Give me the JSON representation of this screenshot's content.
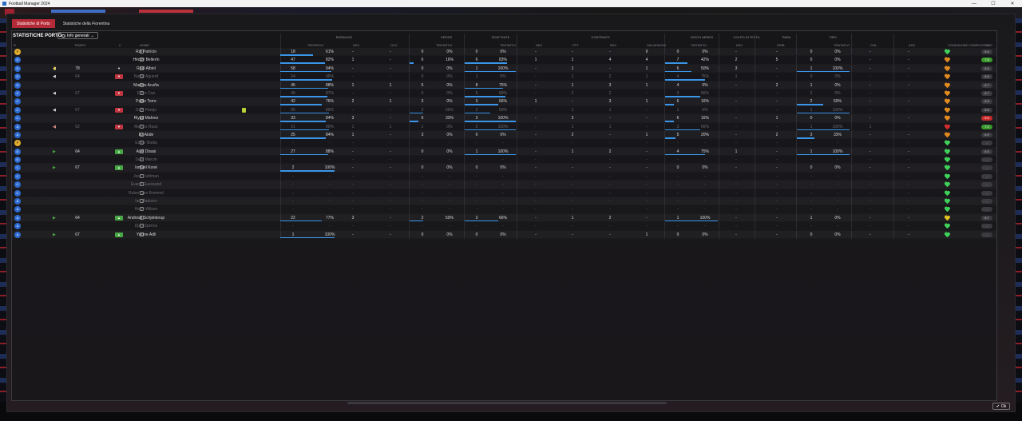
{
  "window": {
    "title": "Football Manager 2024",
    "controls": [
      "—",
      "☐",
      "✕"
    ]
  },
  "tabs": [
    {
      "label": "Statistiche di Porto",
      "active": true
    },
    {
      "label": "Statistiche della Fiorentina",
      "active": false
    }
  ],
  "panel": {
    "title": "STATISTICHE PORTO",
    "view_select": "Info generali"
  },
  "groups": [
    "PASSAGGI",
    "CROSS",
    "SCATTI/ATE",
    "CONTRASTI",
    "GIOCO AEREO",
    "COLPO DI TESTA",
    "PARA",
    "TIRO"
  ],
  "columns": [
    "R",
    "TEMPO",
    "C",
    "NOME",
    "TENTATIVI",
    "DEC",
    "OCC",
    "TENTATIVI",
    "TENTATIVI",
    "DEC",
    "FPT",
    "REC",
    "SALVATAGGI",
    "TENTATIVI",
    "DEC",
    "DRIB",
    "TENTATIVI",
    "GOL",
    "ASS",
    "CONDIZIONE COMPLESSIV...",
    "VOT"
  ],
  "colors": {
    "accent": "#b52a37",
    "bar": "#3a95e8",
    "heart_green": "#3fd15a",
    "heart_yellow": "#e0c020",
    "heart_orange": "#e08a20",
    "heart_red": "#d32d2d"
  },
  "players": [
    {
      "pos": "P",
      "gk": true,
      "name": "Rui Patrício",
      "pass": [
        "18",
        "61%"
      ],
      "dec": "-",
      "occ": "-",
      "cross": [
        "0",
        "0%"
      ],
      "sc": [
        "0",
        "0%"
      ],
      "tdec": "-",
      "fpt": "-",
      "rec": "-",
      "salv": "9",
      "aer": [
        "0",
        "0%"
      ],
      "hdec": "-",
      "drib": "-",
      "shot": [
        "0",
        "0%"
      ],
      "gol": "-",
      "ass": "-",
      "cond": "#3fd15a",
      "vot": "6.6",
      "vclass": "",
      "dim": false
    },
    {
      "pos": "D",
      "name": "Héctor Bellerín",
      "pass": [
        "47",
        "82%"
      ],
      "dec": "1",
      "occ": "-",
      "cross": [
        "6",
        "16%"
      ],
      "sc": [
        "6",
        "83%"
      ],
      "tdec": "1",
      "fpt": "1",
      "rec": "4",
      "salv": "4",
      "aer": [
        "7",
        "42%"
      ],
      "hdec": "2",
      "drib": "5",
      "shot": [
        "0",
        "0%"
      ],
      "gol": "-",
      "ass": "-",
      "cond": "#e08a20",
      "vot": "7.5",
      "vclass": "hi",
      "dim": false
    },
    {
      "pos": "D",
      "name": "Raúl Albiol",
      "time": "78",
      "pass": [
        "58",
        "94%"
      ],
      "dec": "-",
      "occ": "-",
      "cross": [
        "0",
        "0%"
      ],
      "sc": [
        "1",
        "100%"
      ],
      "tdec": "-",
      "fpt": "1",
      "rec": "-",
      "salv": "1",
      "aer": [
        "6",
        "50%"
      ],
      "hdec": "3",
      "drib": "-",
      "shot": [
        "1",
        "100%"
      ],
      "gol": "-",
      "ass": "-",
      "cond": "#e08a20",
      "vot": "6.6",
      "vclass": "",
      "dim": false
    },
    {
      "pos": "D",
      "name": "Nayef Aguerd",
      "time": "64",
      "badge": "sub-off",
      "pass": [
        "24",
        "95%"
      ],
      "dec": "-",
      "occ": "-",
      "cross": [
        "0",
        "0%"
      ],
      "sc": [
        "1",
        "0%"
      ],
      "tdec": "-",
      "fpt": "1",
      "rec": "2",
      "salv": "1",
      "aer": [
        "4",
        "75%"
      ],
      "hdec": "1",
      "drib": "-",
      "shot": [
        "0",
        "0%"
      ],
      "gol": "-",
      "ass": "-",
      "cond": "#e08a20",
      "vot": "6.5",
      "vclass": "",
      "dim": true
    },
    {
      "pos": "D",
      "name": "Marcos Acuña",
      "pass": [
        "45",
        "88%"
      ],
      "dec": "1",
      "occ": "1",
      "cross": [
        "5",
        "0%"
      ],
      "sc": [
        "8",
        "75%"
      ],
      "tdec": "-",
      "fpt": "1",
      "rec": "3",
      "salv": "1",
      "aer": [
        "4",
        "0%"
      ],
      "hdec": "-",
      "drib": "2",
      "shot": [
        "1",
        "0%"
      ],
      "gol": "-",
      "ass": "-",
      "cond": "#e08a20",
      "vot": "6.7",
      "vclass": "",
      "dim": false
    },
    {
      "pos": "C",
      "name": "Emre Can",
      "time": "67",
      "badge": "sub-off",
      "pass": [
        "49",
        "87%"
      ],
      "dec": "-",
      "occ": "-",
      "cross": [
        "0",
        "0%"
      ],
      "sc": [
        "5",
        "80%"
      ],
      "tdec": "-",
      "fpt": "2",
      "rec": "2",
      "salv": "-",
      "aer": [
        "3",
        "66%"
      ],
      "hdec": "-",
      "drib": "-",
      "shot": [
        "2",
        "0%"
      ],
      "gol": "-",
      "ass": "-",
      "cond": "#e08a20",
      "vot": "6.7",
      "vclass": "",
      "dim": true
    },
    {
      "pos": "C",
      "name": "Pablo Torre",
      "pass": [
        "42",
        "76%"
      ],
      "dec": "2",
      "occ": "1",
      "cross": [
        "3",
        "0%"
      ],
      "sc": [
        "3",
        "66%"
      ],
      "tdec": "1",
      "fpt": "-",
      "rec": "3",
      "salv": "1",
      "aer": [
        "6",
        "16%"
      ],
      "hdec": "-",
      "drib": "-",
      "shot": [
        "2",
        "50%"
      ],
      "gol": "-",
      "ass": "-",
      "cond": "#e08a20",
      "vot": "6.5",
      "vclass": "",
      "dim": false
    },
    {
      "pos": "C",
      "name": "Dani Parejo",
      "time": "67",
      "badge": "sub-off",
      "card": true,
      "pass": [
        "55",
        "89%"
      ],
      "dec": "-",
      "occ": "-",
      "cross": [
        "2",
        "50%"
      ],
      "sc": [
        "2",
        "50%"
      ],
      "tdec": "-",
      "fpt": "1",
      "rec": "1",
      "salv": "-",
      "aer": [
        "1",
        "0%"
      ],
      "hdec": "-",
      "drib": "-",
      "shot": [
        "1",
        "100%"
      ],
      "gol": "-",
      "ass": "-",
      "cond": "#e08a20",
      "vot": "6.6",
      "vclass": "",
      "dim": true
    },
    {
      "pos": "C",
      "name": "Riyad Mahrez",
      "pass": [
        "33",
        "84%"
      ],
      "dec": "3",
      "occ": "-",
      "cross": [
        "6",
        "33%"
      ],
      "sc": [
        "3",
        "100%"
      ],
      "tdec": "-",
      "fpt": "3",
      "rec": "-",
      "salv": "-",
      "aer": [
        "6",
        "16%"
      ],
      "hdec": "-",
      "drib": "1",
      "shot": [
        "0",
        "0%"
      ],
      "gol": "-",
      "ass": "-",
      "cond": "#e08a20",
      "vot": "5.5",
      "vclass": "lo",
      "dim": false
    },
    {
      "pos": "A",
      "name": "Marcos Raus",
      "time": "62",
      "badge": "sub-off",
      "ball": true,
      "pass": [
        "21",
        "90%"
      ],
      "dec": "1",
      "occ": "1",
      "cross": [
        "1",
        "0%"
      ],
      "sc": [
        "2",
        "100%"
      ],
      "tdec": "-",
      "fpt": "1",
      "rec": "1",
      "salv": "-",
      "aer": [
        "3",
        "66%"
      ],
      "hdec": "-",
      "drib": "-",
      "shot": [
        "1",
        "100%"
      ],
      "gol": "1",
      "ass": "-",
      "cond": "#d32d2d",
      "vot": "7.2",
      "vclass": "hi",
      "dim": true
    },
    {
      "pos": "A",
      "name": "Ez Abde",
      "pass": [
        "25",
        "84%"
      ],
      "dec": "1",
      "occ": "-",
      "cross": [
        "3",
        "0%"
      ],
      "sc": [
        "0",
        "0%"
      ],
      "tdec": "-",
      "fpt": "2",
      "rec": "-",
      "salv": "1",
      "aer": [
        "5",
        "20%"
      ],
      "hdec": "-",
      "drib": "2",
      "shot": [
        "3",
        "33%"
      ],
      "gol": "-",
      "ass": "-",
      "cond": "#e08a20",
      "vot": "6.9",
      "vclass": "",
      "dim": false
    },
    {
      "pos": "P",
      "gk": true,
      "name": "Edgar Badia",
      "pass": [
        "-",
        "-"
      ],
      "dec": "-",
      "occ": "-",
      "cross": [
        "-",
        "-"
      ],
      "sc": [
        "-",
        "-"
      ],
      "tdec": "-",
      "fpt": "-",
      "rec": "-",
      "salv": "-",
      "aer": [
        "-",
        "-"
      ],
      "hdec": "-",
      "drib": "-",
      "shot": [
        "-",
        "-"
      ],
      "gol": "-",
      "ass": "-",
      "cond": "#3fd15a",
      "vot": "-",
      "vclass": "",
      "dim": true
    },
    {
      "pos": "D",
      "name": "Axel Disasi",
      "time": "64",
      "badge": "sub-on",
      "pass": [
        "27",
        "88%"
      ],
      "dec": "-",
      "occ": "-",
      "cross": [
        "0",
        "0%"
      ],
      "sc": [
        "1",
        "100%"
      ],
      "tdec": "-",
      "fpt": "1",
      "rec": "2",
      "salv": "-",
      "aer": [
        "4",
        "75%"
      ],
      "hdec": "1",
      "drib": "-",
      "shot": [
        "1",
        "100%"
      ],
      "gol": "-",
      "ass": "-",
      "cond": "#3fd15a",
      "vot": "6.5",
      "vclass": "",
      "dim": false
    },
    {
      "pos": "D",
      "name": "Sully Marcin",
      "pass": [
        "-",
        "-"
      ],
      "dec": "-",
      "occ": "-",
      "cross": [
        "-",
        "-"
      ],
      "sc": [
        "-",
        "-"
      ],
      "tdec": "-",
      "fpt": "-",
      "rec": "-",
      "salv": "-",
      "aer": [
        "-",
        "-"
      ],
      "hdec": "-",
      "drib": "-",
      "shot": [
        "-",
        "-"
      ],
      "gol": "-",
      "ass": "-",
      "cond": "#3fd15a",
      "vot": "-",
      "vclass": "",
      "dim": true
    },
    {
      "pos": "C",
      "name": "Ismaël Koné",
      "time": "67",
      "badge": "sub-on",
      "pass": [
        "2",
        "100%"
      ],
      "dec": "-",
      "occ": "-",
      "cross": [
        "0",
        "0%"
      ],
      "sc": [
        "0",
        "0%"
      ],
      "tdec": "-",
      "fpt": "-",
      "rec": "-",
      "salv": "-",
      "aer": [
        "0",
        "0%"
      ],
      "hdec": "-",
      "drib": "-",
      "shot": [
        "0",
        "0%"
      ],
      "gol": "-",
      "ass": "-",
      "cond": "#3fd15a",
      "vot": "-",
      "vclass": "",
      "dim": false
    },
    {
      "pos": "C",
      "name": "Jesé Kuhlman",
      "pass": [
        "-",
        "-"
      ],
      "dec": "-",
      "occ": "-",
      "cross": [
        "-",
        "-"
      ],
      "sc": [
        "-",
        "-"
      ],
      "tdec": "-",
      "fpt": "-",
      "rec": "-",
      "salv": "-",
      "aer": [
        "-",
        "-"
      ],
      "hdec": "-",
      "drib": "-",
      "shot": [
        "-",
        "-"
      ],
      "gol": "-",
      "ass": "-",
      "cond": "#3fd15a",
      "vot": "-",
      "vclass": "",
      "dim": true
    },
    {
      "pos": "C",
      "name": "Evann Guessand",
      "pass": [
        "-",
        "-"
      ],
      "dec": "-",
      "occ": "-",
      "cross": [
        "-",
        "-"
      ],
      "sc": [
        "-",
        "-"
      ],
      "tdec": "-",
      "fpt": "-",
      "rec": "-",
      "salv": "-",
      "aer": [
        "-",
        "-"
      ],
      "hdec": "-",
      "drib": "-",
      "shot": [
        "-",
        "-"
      ],
      "gol": "-",
      "ass": "-",
      "cond": "#3fd15a",
      "vot": "-",
      "vclass": "",
      "dim": true
    },
    {
      "pos": "C",
      "name": "Ruben van Bommel",
      "pass": [
        "-",
        "-"
      ],
      "dec": "-",
      "occ": "-",
      "cross": [
        "-",
        "-"
      ],
      "sc": [
        "-",
        "-"
      ],
      "tdec": "-",
      "fpt": "-",
      "rec": "-",
      "salv": "-",
      "aer": [
        "-",
        "-"
      ],
      "hdec": "-",
      "drib": "-",
      "shot": [
        "-",
        "-"
      ],
      "gol": "-",
      "ass": "-",
      "cond": "#3fd15a",
      "vot": "-",
      "vclass": "",
      "dim": true
    },
    {
      "pos": "A",
      "name": "Ian Maatsen",
      "pass": [
        "-",
        "-"
      ],
      "dec": "-",
      "occ": "-",
      "cross": [
        "-",
        "-"
      ],
      "sc": [
        "-",
        "-"
      ],
      "tdec": "-",
      "fpt": "-",
      "rec": "-",
      "salv": "-",
      "aer": [
        "-",
        "-"
      ],
      "hdec": "-",
      "drib": "-",
      "shot": [
        "-",
        "-"
      ],
      "gol": "-",
      "ass": "-",
      "cond": "#3fd15a",
      "vot": "-",
      "vclass": "",
      "dim": true
    },
    {
      "pos": "A",
      "name": "Harry Wilson",
      "pass": [
        "-",
        "-"
      ],
      "dec": "-",
      "occ": "-",
      "cross": [
        "-",
        "-"
      ],
      "sc": [
        "-",
        "-"
      ],
      "tdec": "-",
      "fpt": "-",
      "rec": "-",
      "salv": "-",
      "aer": [
        "-",
        "-"
      ],
      "hdec": "-",
      "drib": "-",
      "shot": [
        "-",
        "-"
      ],
      "gol": "-",
      "ass": "-",
      "cond": "#3fd15a",
      "vot": "-",
      "vclass": "",
      "dim": true
    },
    {
      "pos": "A",
      "name": "Andreas Schjelderup",
      "time": "64",
      "badge": "sub-on",
      "pass": [
        "22",
        "77%"
      ],
      "dec": "3",
      "occ": "-",
      "cross": [
        "2",
        "50%"
      ],
      "sc": [
        "3",
        "66%"
      ],
      "tdec": "-",
      "fpt": "1",
      "rec": "2",
      "salv": "-",
      "aer": [
        "1",
        "100%"
      ],
      "hdec": "-",
      "drib": "-",
      "shot": [
        "1",
        "0%"
      ],
      "gol": "-",
      "ass": "-",
      "cond": "#e0c020",
      "vot": "6.7",
      "vclass": "",
      "dim": false
    },
    {
      "pos": "A",
      "name": "Djed Spence",
      "pass": [
        "-",
        "-"
      ],
      "dec": "-",
      "occ": "-",
      "cross": [
        "-",
        "-"
      ],
      "sc": [
        "-",
        "-"
      ],
      "tdec": "-",
      "fpt": "-",
      "rec": "-",
      "salv": "-",
      "aer": [
        "-",
        "-"
      ],
      "hdec": "-",
      "drib": "-",
      "shot": [
        "-",
        "-"
      ],
      "gol": "-",
      "ass": "-",
      "cond": "#3fd15a",
      "vot": "-",
      "vclass": "",
      "dim": true
    },
    {
      "pos": "A",
      "name": "Yacine Adli",
      "time": "67",
      "badge": "sub-on",
      "pass": [
        "1",
        "100%"
      ],
      "dec": "-",
      "occ": "-",
      "cross": [
        "0",
        "0%"
      ],
      "sc": [
        "0",
        "0%"
      ],
      "tdec": "-",
      "fpt": "-",
      "rec": "-",
      "salv": "1",
      "aer": [
        "0",
        "0%"
      ],
      "hdec": "-",
      "drib": "-",
      "shot": [
        "0",
        "0%"
      ],
      "gol": "-",
      "ass": "-",
      "cond": "#3fd15a",
      "vot": "-",
      "vclass": "",
      "dim": false
    }
  ],
  "ok_button": "Ok"
}
